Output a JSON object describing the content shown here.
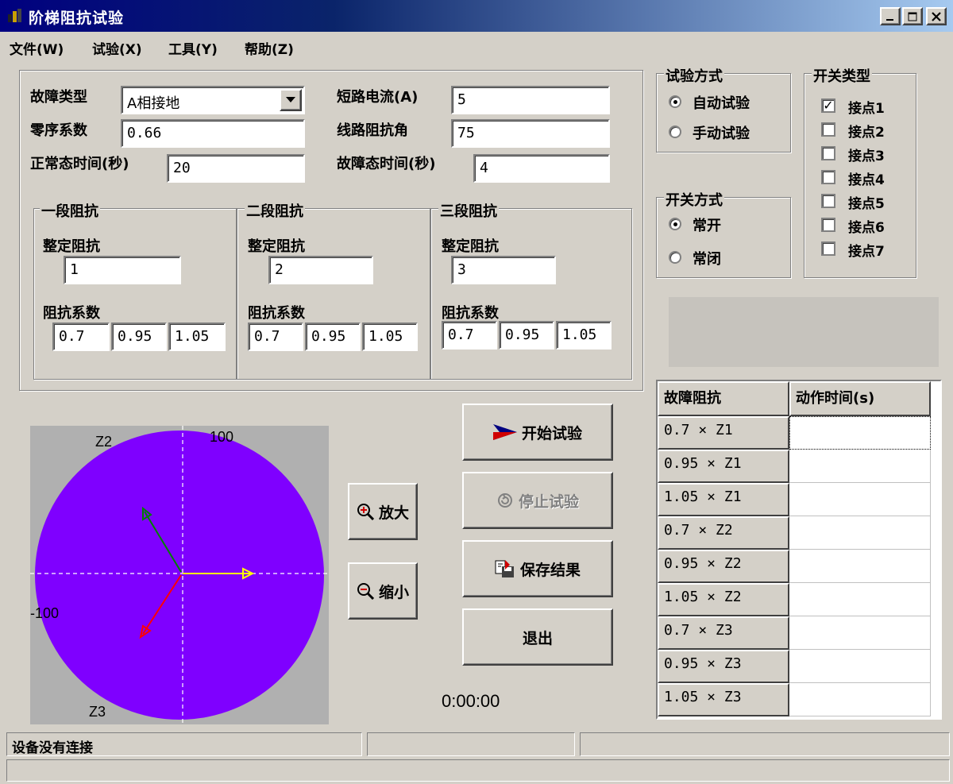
{
  "window": {
    "title": "阶梯阻抗试验",
    "controls": [
      "_",
      "□",
      "×"
    ]
  },
  "menu": [
    {
      "label": "文件(W)"
    },
    {
      "label": "试验(X)"
    },
    {
      "label": "工具(Y)"
    },
    {
      "label": "帮助(Z)"
    }
  ],
  "params": {
    "fault_type_label": "故障类型",
    "fault_type_value": "A相接地",
    "zero_seq_label": "零序系数",
    "zero_seq_value": "0.66",
    "normal_time_label": "正常态时间(秒)",
    "normal_time_value": "20",
    "short_current_label": "短路电流(A)",
    "short_current_value": "5",
    "line_angle_label": "线路阻抗角",
    "line_angle_value": "75",
    "fault_time_label": "故障态时间(秒)",
    "fault_time_value": "4"
  },
  "zones": [
    {
      "title": "一段阻抗",
      "setting_label": "整定阻抗",
      "setting_value": "1",
      "coef_label": "阻抗系数",
      "coefs": [
        "0.7",
        "0.95",
        "1.05"
      ]
    },
    {
      "title": "二段阻抗",
      "setting_label": "整定阻抗",
      "setting_value": "2",
      "coef_label": "阻抗系数",
      "coefs": [
        "0.7",
        "0.95",
        "1.05"
      ]
    },
    {
      "title": "三段阻抗",
      "setting_label": "整定阻抗",
      "setting_value": "3",
      "coef_label": "阻抗系数",
      "coefs": [
        "0.7",
        "0.95",
        "1.05"
      ]
    }
  ],
  "test_mode": {
    "title": "试验方式",
    "options": [
      {
        "label": "自动试验",
        "selected": true
      },
      {
        "label": "手动试验",
        "selected": false
      }
    ]
  },
  "switch_mode": {
    "title": "开关方式",
    "options": [
      {
        "label": "常开",
        "selected": true
      },
      {
        "label": "常闭",
        "selected": false
      }
    ]
  },
  "switch_type": {
    "title": "开关类型",
    "contacts": [
      {
        "label": "接点1",
        "checked": true
      },
      {
        "label": "接点2",
        "checked": false
      },
      {
        "label": "接点3",
        "checked": false
      },
      {
        "label": "接点4",
        "checked": false
      },
      {
        "label": "接点5",
        "checked": false
      },
      {
        "label": "接点6",
        "checked": false
      },
      {
        "label": "接点7",
        "checked": false
      }
    ]
  },
  "plot": {
    "labels": {
      "z2": "Z2",
      "top": "100",
      "left": "-100",
      "z3": "Z3"
    },
    "colors": {
      "circle": "#7f00ff",
      "background": "#b0b0b0",
      "axes": "#ffffff",
      "phase_a": "#ffff00",
      "phase_b": "#008000",
      "phase_c": "#ff0000"
    }
  },
  "zoom": {
    "in_label": "放大",
    "out_label": "缩小"
  },
  "actions": {
    "start_label": "开始试验",
    "stop_label": "停止试验",
    "save_label": "保存结果",
    "exit_label": "退出",
    "stop_enabled": false
  },
  "timer": "0:00:00",
  "results": {
    "headers": [
      "故障阻抗",
      "动作时间(s)"
    ],
    "rows": [
      {
        "impedance": "0.7 × Z1",
        "time": ""
      },
      {
        "impedance": "0.95 × Z1",
        "time": ""
      },
      {
        "impedance": "1.05 × Z1",
        "time": ""
      },
      {
        "impedance": "0.7 × Z2",
        "time": ""
      },
      {
        "impedance": "0.95 × Z2",
        "time": ""
      },
      {
        "impedance": "1.05 × Z2",
        "time": ""
      },
      {
        "impedance": "0.7 × Z3",
        "time": ""
      },
      {
        "impedance": "0.95 × Z3",
        "time": ""
      },
      {
        "impedance": "1.05 × Z3",
        "time": ""
      }
    ]
  },
  "status": {
    "connection": "设备没有连接",
    "pane2": "",
    "pane3": "",
    "bottom": ""
  }
}
